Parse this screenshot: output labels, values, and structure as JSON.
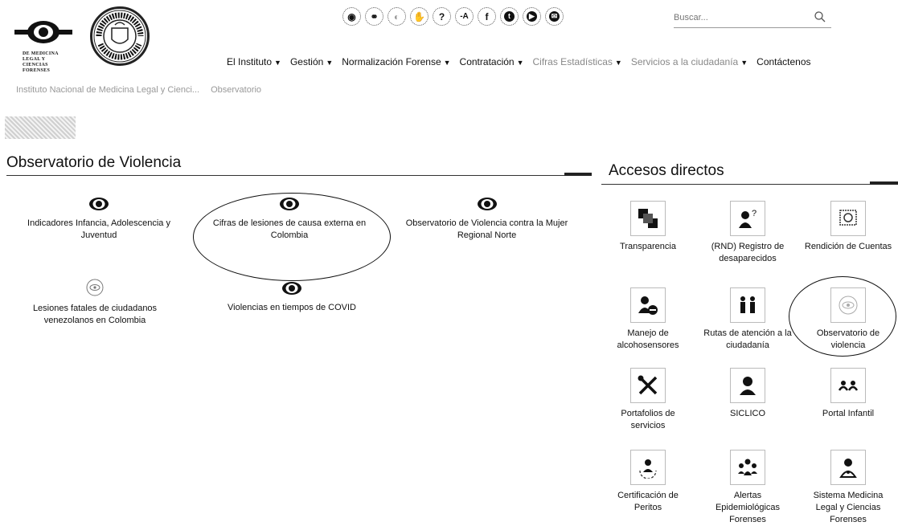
{
  "header": {
    "logo1_lines": [
      "DE MEDICINA",
      "LEGAL Y",
      "CIENCIAS",
      "FORENSES"
    ],
    "logo2_label": "REPÚBLICA DE COLOMBIA",
    "social_icons": [
      "accessibility-icon",
      "ear-icon",
      "contrast-icon",
      "sign-language-icon",
      "help-icon",
      "font-size-icon",
      "facebook-icon",
      "twitter-icon",
      "youtube-icon",
      "mail-icon"
    ],
    "search": {
      "placeholder": "Buscar...",
      "value": ""
    }
  },
  "nav": [
    {
      "label": "El Instituto",
      "caret": "▼",
      "faded": false
    },
    {
      "label": "Gestión",
      "caret": "▼",
      "faded": false
    },
    {
      "label": "Normalización Forense",
      "caret": "▼",
      "faded": false
    },
    {
      "label": "Contratación",
      "caret": "▼",
      "faded": false
    },
    {
      "label": "Cifras Estadísticas",
      "caret": "▼",
      "faded": true
    },
    {
      "label": "Servicios a la ciudadanía",
      "caret": "▼",
      "faded": true
    },
    {
      "label": "Contáctenos",
      "caret": "",
      "faded": false
    }
  ],
  "breadcrumb": [
    "Instituto Nacional de Medicina Legal y Cienci...",
    "Observatorio"
  ],
  "observatorio": {
    "title": "Observatorio de Violencia",
    "items": [
      {
        "label": "Indicadores Infancia, Adolescencia y Juventud",
        "icon": "eye-icon"
      },
      {
        "label": "Cifras de lesiones de causa externa en Colombia",
        "icon": "eye-icon"
      },
      {
        "label": "Observatorio de Violencia contra la Mujer Regional Norte",
        "icon": "eye-icon"
      },
      {
        "label": "Lesiones fatales de ciudadanos venezolanos en Colombia",
        "icon": "eye-outline-icon"
      },
      {
        "label": "Violencias en tiempos de COVID",
        "icon": "eye-icon"
      }
    ]
  },
  "accesos": {
    "title": "Accesos directos",
    "items": [
      {
        "label": "Transparencia",
        "icon": "transparency-icon"
      },
      {
        "label": "(RND) Registro de desaparecidos",
        "icon": "missing-person-icon"
      },
      {
        "label": "Rendición de Cuentas",
        "icon": "accountability-icon"
      },
      {
        "label": "Manejo de alcohosensores",
        "icon": "breathalyzer-icon"
      },
      {
        "label": "Rutas de atención a la ciudadanía",
        "icon": "routes-icon"
      },
      {
        "label": "Observatorio de violencia",
        "icon": "eye-outline-icon"
      },
      {
        "label": "Portafolios de servicios",
        "icon": "tools-icon"
      },
      {
        "label": "SICLICO",
        "icon": "user-icon"
      },
      {
        "label": "Portal Infantil",
        "icon": "children-icon"
      },
      {
        "label": "Certificación de Peritos",
        "icon": "certification-icon"
      },
      {
        "label": "Alertas Epidemiológicas Forenses",
        "icon": "group-alert-icon"
      },
      {
        "label": "Sistema Medicina Legal y Ciencias Forenses",
        "icon": "doctor-icon"
      }
    ]
  }
}
